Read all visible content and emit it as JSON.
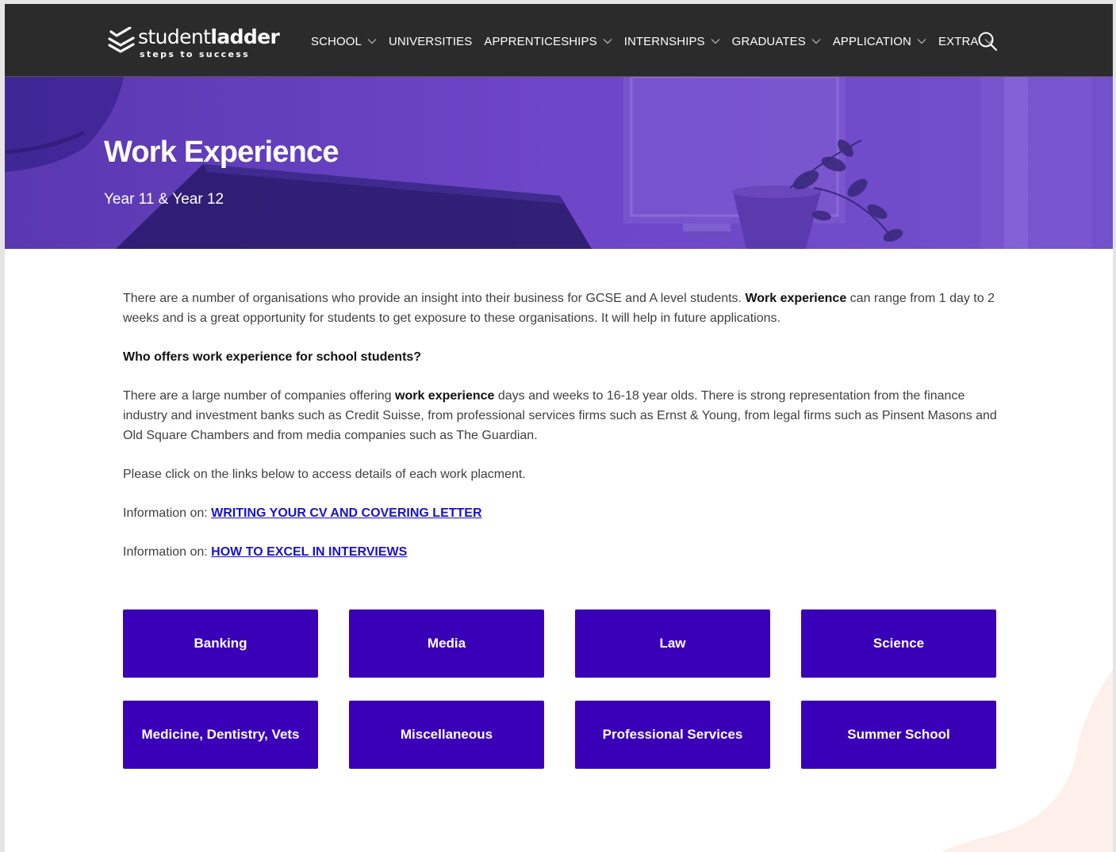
{
  "header": {
    "logo": {
      "word_regular": "student",
      "word_bold": "ladder",
      "tagline": "steps to success"
    },
    "nav": [
      {
        "label": "SCHOOL",
        "dropdown": true
      },
      {
        "label": "UNIVERSITIES",
        "dropdown": false
      },
      {
        "label": "APPRENTICESHIPS",
        "dropdown": true
      },
      {
        "label": "INTERNSHIPS",
        "dropdown": true
      },
      {
        "label": "GRADUATES",
        "dropdown": true
      },
      {
        "label": "APPLICATION",
        "dropdown": true
      },
      {
        "label": "EXTRA",
        "dropdown": true
      }
    ],
    "search_icon": "search-icon"
  },
  "hero": {
    "title": "Work Experience",
    "subtitle": "Year 11 & Year 12"
  },
  "content": {
    "intro": {
      "before": "There are a number of organisations who provide an insight into their business for GCSE and A level students. ",
      "bold": "Work experience",
      "after": " can range from 1 day to 2 weeks and is a great opportunity for students to get exposure to these organisations. It will help in future applications."
    },
    "question": "Who offers work experience for school students?",
    "answer": {
      "before": "There are a large number of companies offering ",
      "bold": "work experience",
      "after": " days and weeks to 16-18 year olds. There is strong representation from the finance industry and investment banks such as Credit Suisse, from professional services firms such as Ernst & Young, from legal firms such as Pinsent Masons and Old Square Chambers and from media companies such as The Guardian."
    },
    "click_note": "Please click on the links below to access details of each work placment.",
    "info_links": [
      {
        "prefix": "Information on: ",
        "link": "WRITING YOUR CV AND COVERING LETTER"
      },
      {
        "prefix": "Information on: ",
        "link": "HOW TO EXCEL IN INTERVIEWS"
      }
    ]
  },
  "tiles": [
    "Banking",
    "Media",
    "Law",
    "Science",
    "Medicine, Dentistry, Vets",
    "Miscellaneous",
    "Professional Services",
    "Summer School"
  ],
  "colors": {
    "header_bg": "#2b2b2b",
    "hero_purple": "#6c45c4",
    "tile_bg": "#3a00b8",
    "link": "#1a12c8",
    "deco_peach": "#fdf0ea"
  }
}
